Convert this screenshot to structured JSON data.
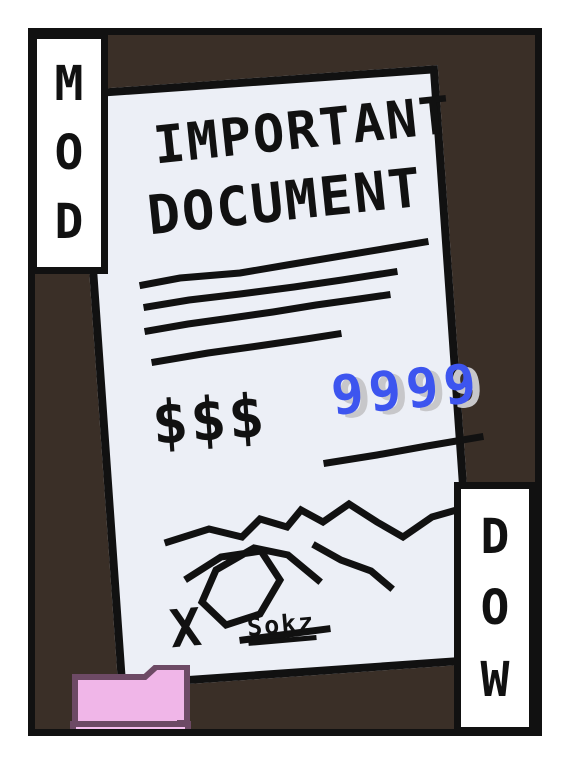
{
  "card": {
    "top_label_letters": [
      "M",
      "O",
      "D"
    ],
    "bottom_label_letters": [
      "D",
      "O",
      "W"
    ],
    "document": {
      "title_line_1": "IMPORTANT",
      "title_line_2": "DOCUMENT",
      "currency": "$$$",
      "value": "9999",
      "sign_mark": "X",
      "sign_name": "Sokz"
    }
  },
  "colors": {
    "background": "#3a2f27",
    "paper": "#eceff6",
    "ink": "#111111",
    "blue_ink": "#3d55ef",
    "folder": "#f0b6e8"
  }
}
